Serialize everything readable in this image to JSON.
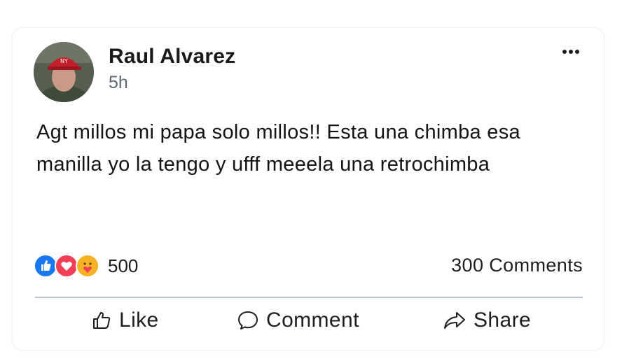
{
  "post": {
    "author_name": "Raul Alvarez",
    "timestamp": "5h",
    "text": "Agt millos mi papa solo millos!! Esta una chimba esa manilla yo la tengo y ufff meeela una retrochimba",
    "avatar_icon": "profile-photo"
  },
  "stats": {
    "reactions_count": "500",
    "reaction_types": [
      "like",
      "love",
      "care"
    ],
    "comments_label": "300 Comments"
  },
  "actions": {
    "like_label": "Like",
    "comment_label": "Comment",
    "share_label": "Share"
  },
  "colors": {
    "like_blue": "#1877f2",
    "love_red": "#f33e58",
    "care_yellow": "#f7b125",
    "divider": "#b9c2cc"
  }
}
